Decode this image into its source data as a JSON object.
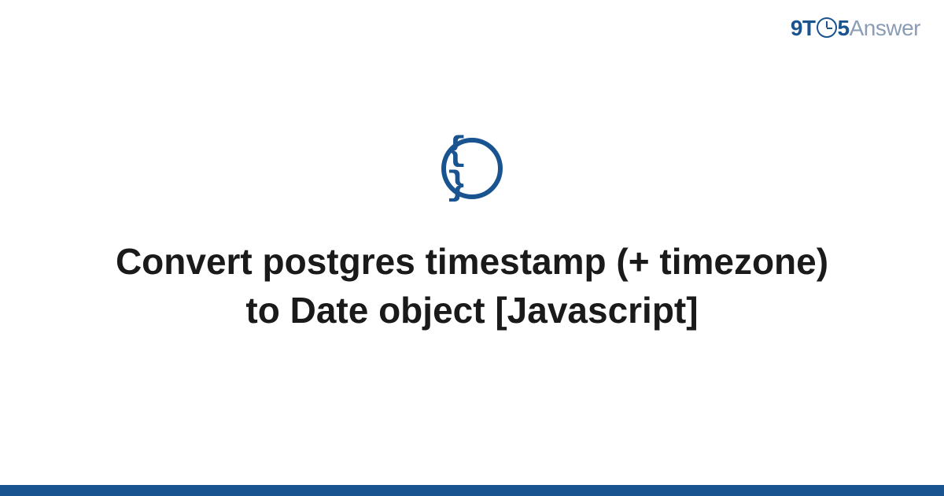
{
  "logo": {
    "prefix": "9T",
    "suffix": "5",
    "word": "Answer"
  },
  "category": {
    "icon_glyph": "{ }",
    "icon_name": "code-braces-icon"
  },
  "title": "Convert postgres timestamp (+ timezone) to Date object [Javascript]",
  "colors": {
    "accent": "#1a5490",
    "muted": "#8a9db5"
  }
}
